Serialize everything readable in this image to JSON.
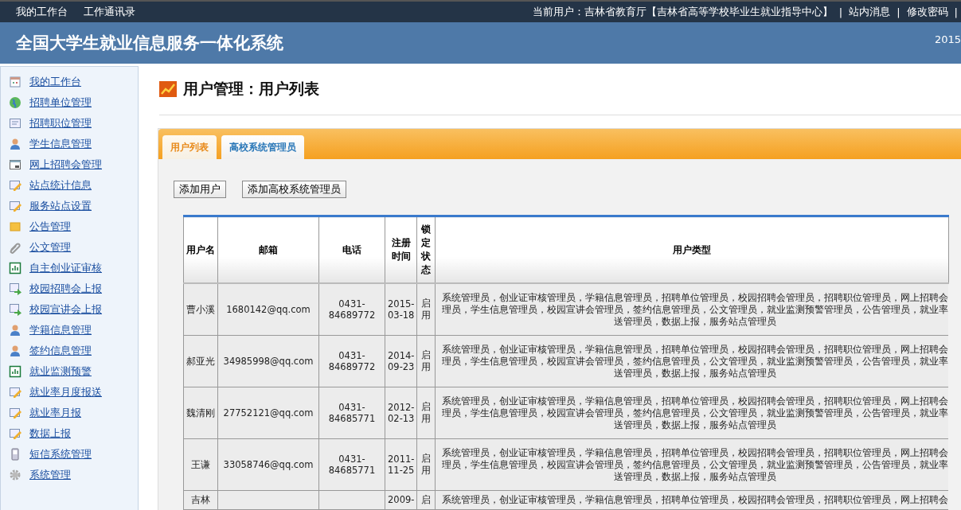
{
  "top_bar": {
    "links": [
      "我的工作台",
      "工作通讯录"
    ],
    "current_user": "当前用户：吉林省教育厅【吉林省高等学校毕业生就业指导中心】",
    "actions": [
      "站内消息",
      "修改密码"
    ],
    "separators": [
      "|",
      "|",
      "|"
    ]
  },
  "header": {
    "title": "全国大学生就业信息服务一体化系统",
    "date": "2015"
  },
  "sidebar": {
    "items": [
      {
        "label": "我的工作台",
        "kind": "calendar"
      },
      {
        "label": "招聘单位管理",
        "kind": "globe"
      },
      {
        "label": "招聘职位管理",
        "kind": "form"
      },
      {
        "label": "学生信息管理",
        "kind": "person"
      },
      {
        "label": "网上招聘会管理",
        "kind": "window"
      },
      {
        "label": "站点统计信息",
        "kind": "edit"
      },
      {
        "label": "服务站点设置",
        "kind": "edit"
      },
      {
        "label": "公告管理",
        "kind": "note"
      },
      {
        "label": "公文管理",
        "kind": "clip"
      },
      {
        "label": "自主创业证审核",
        "kind": "chart"
      },
      {
        "label": "校园招聘会上报",
        "kind": "upload"
      },
      {
        "label": "校园宣讲会上报",
        "kind": "upload"
      },
      {
        "label": "学籍信息管理",
        "kind": "person"
      },
      {
        "label": "签约信息管理",
        "kind": "person"
      },
      {
        "label": "就业监测预警",
        "kind": "chart"
      },
      {
        "label": "就业率月度报送",
        "kind": "edit"
      },
      {
        "label": "就业率月报",
        "kind": "edit"
      },
      {
        "label": "数据上报",
        "kind": "edit"
      },
      {
        "label": "短信系统管理",
        "kind": "phone"
      },
      {
        "label": "系统管理",
        "kind": "gear"
      }
    ]
  },
  "page_title": "用户管理：用户列表",
  "tabs": [
    {
      "label": "用户列表",
      "selected": true
    },
    {
      "label": "高校系统管理员",
      "selected": false
    }
  ],
  "buttons": [
    "添加用户",
    "添加高校系统管理员"
  ],
  "table": {
    "columns": [
      "用户名",
      "邮箱",
      "电话",
      "注册时间",
      "锁定状态",
      "用户类型"
    ],
    "rows": [
      {
        "cells": [
          "曹小溪",
          "1680142@qq.com",
          "0431-84689772",
          "2015-03-18",
          "启用"
        ],
        "roles": [
          "系统管理员，创业证审核管理员，学籍信息管理员，招聘单位管理员，校园招聘会管理员，招聘职位管理员，网上招聘会",
          "理员，学生信息管理员，校园宣讲会管理员，签约信息管理员，公文管理员，就业监测预警管理员，公告管理员，就业率",
          "送管理员，数据上报，服务站点管理员"
        ]
      },
      {
        "cells": [
          "郝亚光",
          "34985998@qq.com",
          "0431-84689772",
          "2014-09-23",
          "启用"
        ],
        "roles": [
          "系统管理员，创业证审核管理员，学籍信息管理员，招聘单位管理员，校园招聘会管理员，招聘职位管理员，网上招聘会",
          "理员，学生信息管理员，校园宣讲会管理员，签约信息管理员，公文管理员，就业监测预警管理员，公告管理员，就业率",
          "送管理员，数据上报，服务站点管理员"
        ]
      },
      {
        "cells": [
          "魏清刚",
          "27752121@qq.com",
          "0431-84685771",
          "2012-02-13",
          "启用"
        ],
        "roles": [
          "系统管理员，创业证审核管理员，学籍信息管理员，招聘单位管理员，校园招聘会管理员，招聘职位管理员，网上招聘会",
          "理员，学生信息管理员，校园宣讲会管理员，签约信息管理员，公文管理员，就业监测预警管理员，公告管理员，就业率",
          "送管理员，数据上报，服务站点管理员"
        ]
      },
      {
        "cells": [
          "王谦",
          "33058746@qq.com",
          "0431-84685771",
          "2011-11-25",
          "启用"
        ],
        "roles": [
          "系统管理员，创业证审核管理员，学籍信息管理员，招聘单位管理员，校园招聘会管理员，招聘职位管理员，网上招聘会",
          "理员，学生信息管理员，校园宣讲会管理员，签约信息管理员，公文管理员，就业监测预警管理员，公告管理员，就业率",
          "送管理员，数据上报，服务站点管理员"
        ]
      },
      {
        "cells": [
          "吉林",
          null,
          null,
          "2009-",
          "启"
        ],
        "roles": [
          "系统管理员，创业证审核管理员，学籍信息管理员，招聘单位管理员，校园招聘会管理员，招聘职位管理员，网上招聘会"
        ]
      }
    ]
  }
}
